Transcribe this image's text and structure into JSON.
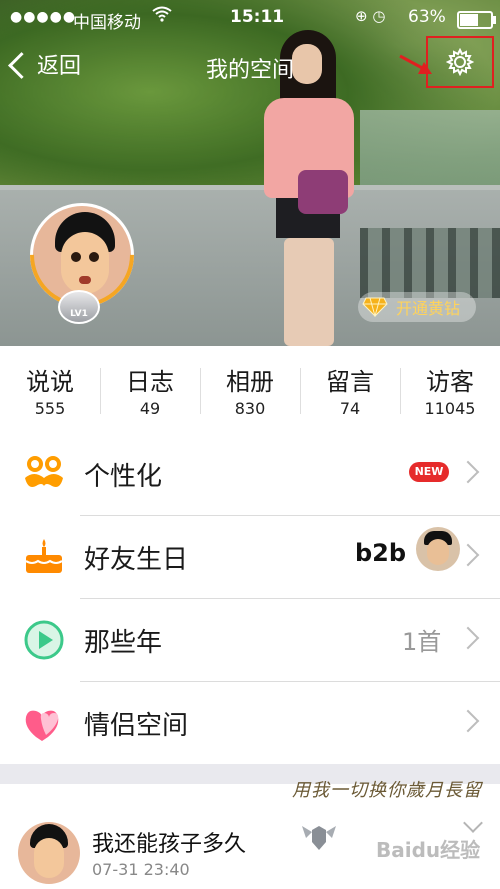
{
  "status_bar": {
    "signal": "●●●●●",
    "carrier": "中国移动",
    "time": "15:11",
    "status_icons": "⊕ ◷",
    "battery": "63%",
    "battery_level": 0.63
  },
  "nav": {
    "back_label": "返回",
    "title": "我的空间"
  },
  "profile": {
    "level_badge": "LV1",
    "vip_label": "开通黄钻"
  },
  "stats": [
    {
      "name": "说说",
      "count": "555"
    },
    {
      "name": "日志",
      "count": "49"
    },
    {
      "name": "相册",
      "count": "830"
    },
    {
      "name": "留言",
      "count": "74"
    },
    {
      "name": "访客",
      "count": "11045"
    }
  ],
  "menu": {
    "personalize": {
      "label": "个性化",
      "badge": "NEW"
    },
    "birthday": {
      "label": "好友生日",
      "friend": "b2b"
    },
    "years": {
      "label": "那些年",
      "count": "1首"
    },
    "couple": {
      "label": "情侣空间"
    }
  },
  "feed": {
    "quote": "用我一切换你歲月長留",
    "title": "我还能孩子多久",
    "time": "07-31 23:40"
  },
  "watermark": "Baidu经验",
  "colors": {
    "accent_red": "#e02020",
    "gold": "#f5a623",
    "new_badge": "#e62b2b"
  }
}
